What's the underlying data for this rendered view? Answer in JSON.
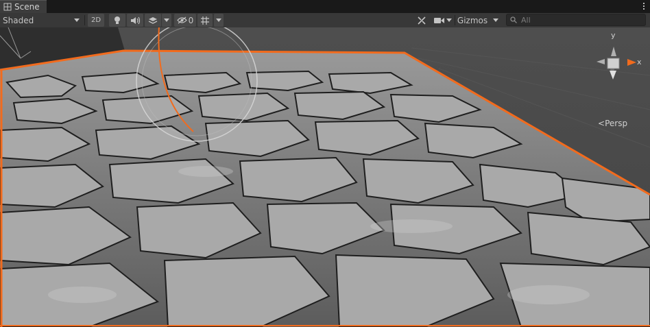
{
  "tab": {
    "label": "Scene",
    "icon": "scene-grid-icon"
  },
  "toolbar": {
    "draw_mode": "Shaded",
    "mode_2d": "2D",
    "hidden_count": "0",
    "gizmos": "Gizmos",
    "search_placeholder": "All"
  },
  "orientation_gizmo": {
    "y": "y",
    "x": "x",
    "projection": "Persp"
  },
  "colors": {
    "selection_outline": "#f26b1d",
    "toolbar_bg": "#383838",
    "viewport_bg": "#474747",
    "tab_bg": "#3c3c3c"
  }
}
